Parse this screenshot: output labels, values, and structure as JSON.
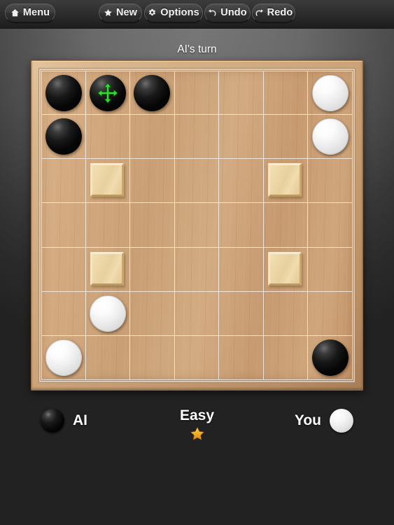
{
  "toolbar": {
    "buttons": [
      {
        "id": "menu",
        "label": "Menu",
        "icon": "home-icon"
      },
      {
        "id": "new",
        "label": "New",
        "icon": "star-icon"
      },
      {
        "id": "options",
        "label": "Options",
        "icon": "gear-icon"
      },
      {
        "id": "undo",
        "label": "Undo",
        "icon": "undo-arrow-icon"
      },
      {
        "id": "redo",
        "label": "Redo",
        "icon": "redo-arrow-icon"
      }
    ]
  },
  "status": {
    "text": "AI's turn"
  },
  "board": {
    "rows": 7,
    "cols": 7,
    "cursor": {
      "row": 0,
      "col": 1,
      "icon": "move-cursor-icon",
      "color": "#2ee02e"
    },
    "cells": [
      [
        "black",
        "black",
        "black",
        "empty",
        "empty",
        "empty",
        "white"
      ],
      [
        "black",
        "empty",
        "empty",
        "empty",
        "empty",
        "empty",
        "white"
      ],
      [
        "empty",
        "tile",
        "empty",
        "empty",
        "empty",
        "tile",
        "empty"
      ],
      [
        "empty",
        "empty",
        "empty",
        "empty",
        "empty",
        "empty",
        "empty"
      ],
      [
        "empty",
        "tile",
        "empty",
        "empty",
        "empty",
        "tile",
        "empty"
      ],
      [
        "empty",
        "white",
        "empty",
        "empty",
        "empty",
        "empty",
        "empty"
      ],
      [
        "white",
        "empty",
        "empty",
        "empty",
        "empty",
        "empty",
        "black"
      ]
    ]
  },
  "footer": {
    "ai": {
      "label": "AI",
      "stone": "black"
    },
    "you": {
      "label": "You",
      "stone": "white"
    },
    "difficulty": {
      "label": "Easy",
      "stars": 1,
      "star_color": "#f0a81e"
    }
  },
  "colors": {
    "background_top": "#6f6f6f",
    "background_bottom": "#222222",
    "board_wood": "#cfa87d",
    "tile_wood": "#eed8a9",
    "gridline": "#f6f4f0",
    "cursor_green": "#2ee02e",
    "star_gold": "#f0a81e"
  }
}
